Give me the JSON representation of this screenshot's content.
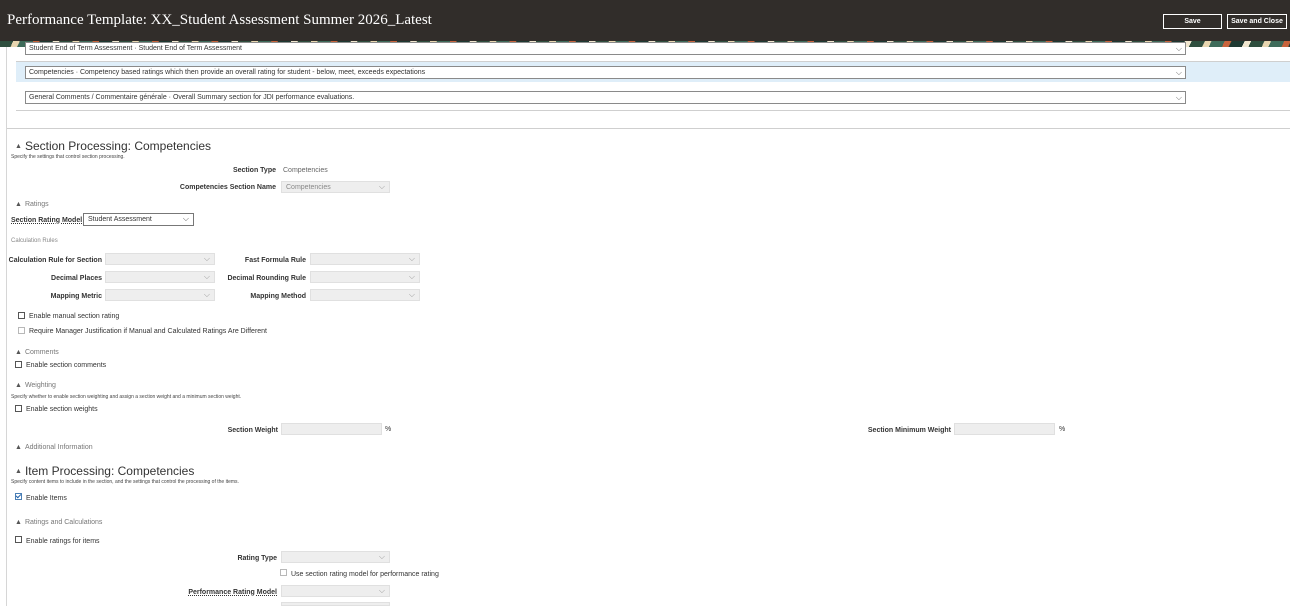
{
  "header": {
    "title": "Performance Template: XX_Student Assessment Summer 2026_Latest",
    "save_label": "Save",
    "save_close_label": "Save and Close"
  },
  "sections_list": [
    {
      "text": "Student End of Term Assessment  ·  Student End of Term Assessment",
      "highlighted": false
    },
    {
      "text": "Competencies  ·  Competency based ratings which then provide an overall rating for student - below, meet, exceeds expectations",
      "highlighted": true
    },
    {
      "text": "General Comments / Commentaire générale  ·  Overall Summary section for JDI performance evaluations.",
      "highlighted": false
    }
  ],
  "section_processing": {
    "heading": "Section Processing: Competencies",
    "hint": "Specify the settings that control section processing.",
    "section_type_label": "Section Type",
    "section_type_value": "Competencies",
    "section_name_label": "Competencies Section Name",
    "section_name_value": "Competencies"
  },
  "ratings": {
    "heading": "Ratings",
    "model_label": "Section Rating Model",
    "model_value": "Student Assessment"
  },
  "calc": {
    "heading": "Calculation Rules",
    "rule_label": "Calculation Rule for Section",
    "decimal_places_label": "Decimal Places",
    "mapping_metric_label": "Mapping Metric",
    "fast_formula_label": "Fast Formula Rule",
    "decimal_rounding_label": "Decimal Rounding Rule",
    "mapping_method_label": "Mapping Method",
    "enable_manual_label": "Enable manual section rating",
    "require_justification_label": "Require Manager Justification if Manual and Calculated Ratings Are Different"
  },
  "comments": {
    "heading": "Comments",
    "enable_label": "Enable section comments"
  },
  "weighting": {
    "heading": "Weighting",
    "hint": "Specify whether to enable section weighting and assign a section weight and a minimum section weight.",
    "enable_label": "Enable section weights",
    "weight_label": "Section Weight",
    "min_weight_label": "Section Minimum Weight",
    "unit": "%"
  },
  "additional": {
    "heading": "Additional Information"
  },
  "item_processing": {
    "heading": "Item Processing: Competencies",
    "hint": "Specify content items to include in the section, and the settings that control the processing of the items.",
    "enable_items_label": "Enable Items",
    "enable_items_checked": true,
    "ratings_calc_heading": "Ratings and Calculations",
    "enable_ratings_label": "Enable ratings for items",
    "rating_type_label": "Rating Type",
    "use_section_model_label": "Use section rating model for performance rating",
    "perf_rating_model_label": "Performance Rating Model"
  },
  "icons": {
    "collapse": "▲",
    "chevron": "⌵"
  }
}
